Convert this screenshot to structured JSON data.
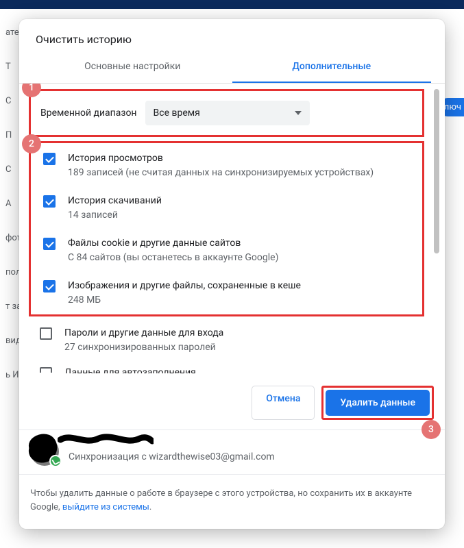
{
  "dialog": {
    "title": "Очистить историю",
    "tabs": {
      "basic": "Основные настройки",
      "advanced": "Дополнительные"
    },
    "time_range": {
      "label": "Временной диапазон",
      "value": "Все время"
    },
    "items": [
      {
        "checked": true,
        "title": "История просмотров",
        "sub": "189 записей (не считая данных на синхронизируемых устройствах)"
      },
      {
        "checked": true,
        "title": "История скачиваний",
        "sub": "14 записей"
      },
      {
        "checked": true,
        "title": "Файлы cookie и другие данные сайтов",
        "sub": "С 84 сайтов (вы останетесь в аккаунте Google)"
      },
      {
        "checked": true,
        "title": "Изображения и другие файлы, сохраненные в кеше",
        "sub": "248 МБ"
      },
      {
        "checked": false,
        "title": "Пароли и другие данные для входа",
        "sub": "27 синхронизированных паролей"
      },
      {
        "checked": false,
        "title": "Данные для автозаполнения",
        "sub": ""
      }
    ],
    "buttons": {
      "cancel": "Отмена",
      "delete": "Удалить данные"
    },
    "account": {
      "sync": "Синхронизация с wizardthewise03@gmail.com"
    },
    "note_prefix": "Чтобы удалить данные о работе в браузере с этого устройства, но сохранить их в аккаунте Google, ",
    "note_link": "выйдите из системы",
    "note_suffix": "."
  },
  "annotations": {
    "badge1": "1",
    "badge2": "2",
    "badge3": "3"
  },
  "background": {
    "side_items": [
      "атель",
      "Т",
      "С",
      "П",
      "С",
      "А",
      "фото",
      "пол",
      "т за",
      "вид",
      "ь И"
    ],
    "right_tag": "люч"
  }
}
